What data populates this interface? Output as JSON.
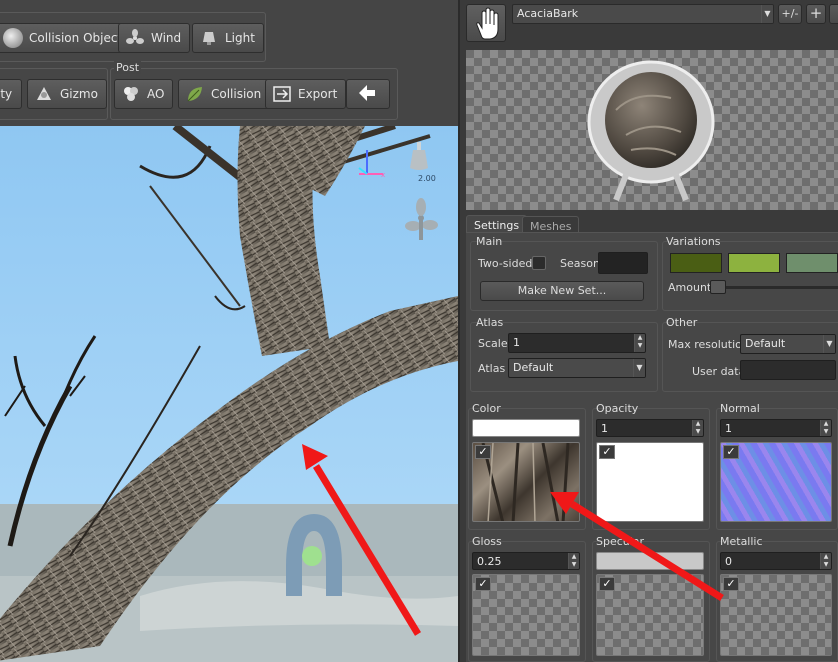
{
  "toolbar": {
    "row1": [
      {
        "label": "Collision Objects",
        "icon": "collision-objects-icon"
      },
      {
        "label": "Wind",
        "icon": "fan-icon"
      },
      {
        "label": "Light",
        "icon": "spotlight-icon"
      }
    ],
    "row2_left": [
      {
        "label": "ity",
        "icon": ""
      },
      {
        "label": "Gizmo",
        "icon": "gizmo-icon"
      }
    ],
    "post_group_label": "Post",
    "post": [
      {
        "label": "AO",
        "icon": "ao-icon"
      },
      {
        "label": "Collision",
        "icon": "leaf-icon"
      },
      {
        "label": "Export",
        "icon": "export-icon"
      }
    ]
  },
  "viewport": {
    "light_value": "2.00",
    "axis_label": "x"
  },
  "panel": {
    "material_name": "AcaciaBark",
    "plusminus_label": "+/-",
    "add_label": "+",
    "tabs": [
      "Settings",
      "Meshes"
    ],
    "main": {
      "title": "Main",
      "two_sided_label": "Two-sided",
      "season_label": "Season",
      "make_new_set_label": "Make New Set..."
    },
    "variations": {
      "title": "Variations",
      "amount_label": "Amount",
      "swatches": [
        "#4a5e14",
        "#8db23f",
        "#6f8f6c"
      ]
    },
    "atlas": {
      "title": "Atlas",
      "scale_label": "Scale",
      "scale_value": "1",
      "atlas_label": "Atlas",
      "atlas_value": "Default"
    },
    "other": {
      "title": "Other",
      "max_res_label": "Max resolution",
      "max_res_value": "Default",
      "user_data_label": "User data",
      "user_data_value": ""
    },
    "maps_row1": [
      {
        "title": "Color",
        "value": ""
      },
      {
        "title": "Opacity",
        "value": "1"
      },
      {
        "title": "Normal",
        "value": "1"
      }
    ],
    "maps_row2": [
      {
        "title": "Gloss",
        "value": "0.25"
      },
      {
        "title": "Specular",
        "value": ""
      },
      {
        "title": "Metallic",
        "value": "0"
      }
    ]
  }
}
